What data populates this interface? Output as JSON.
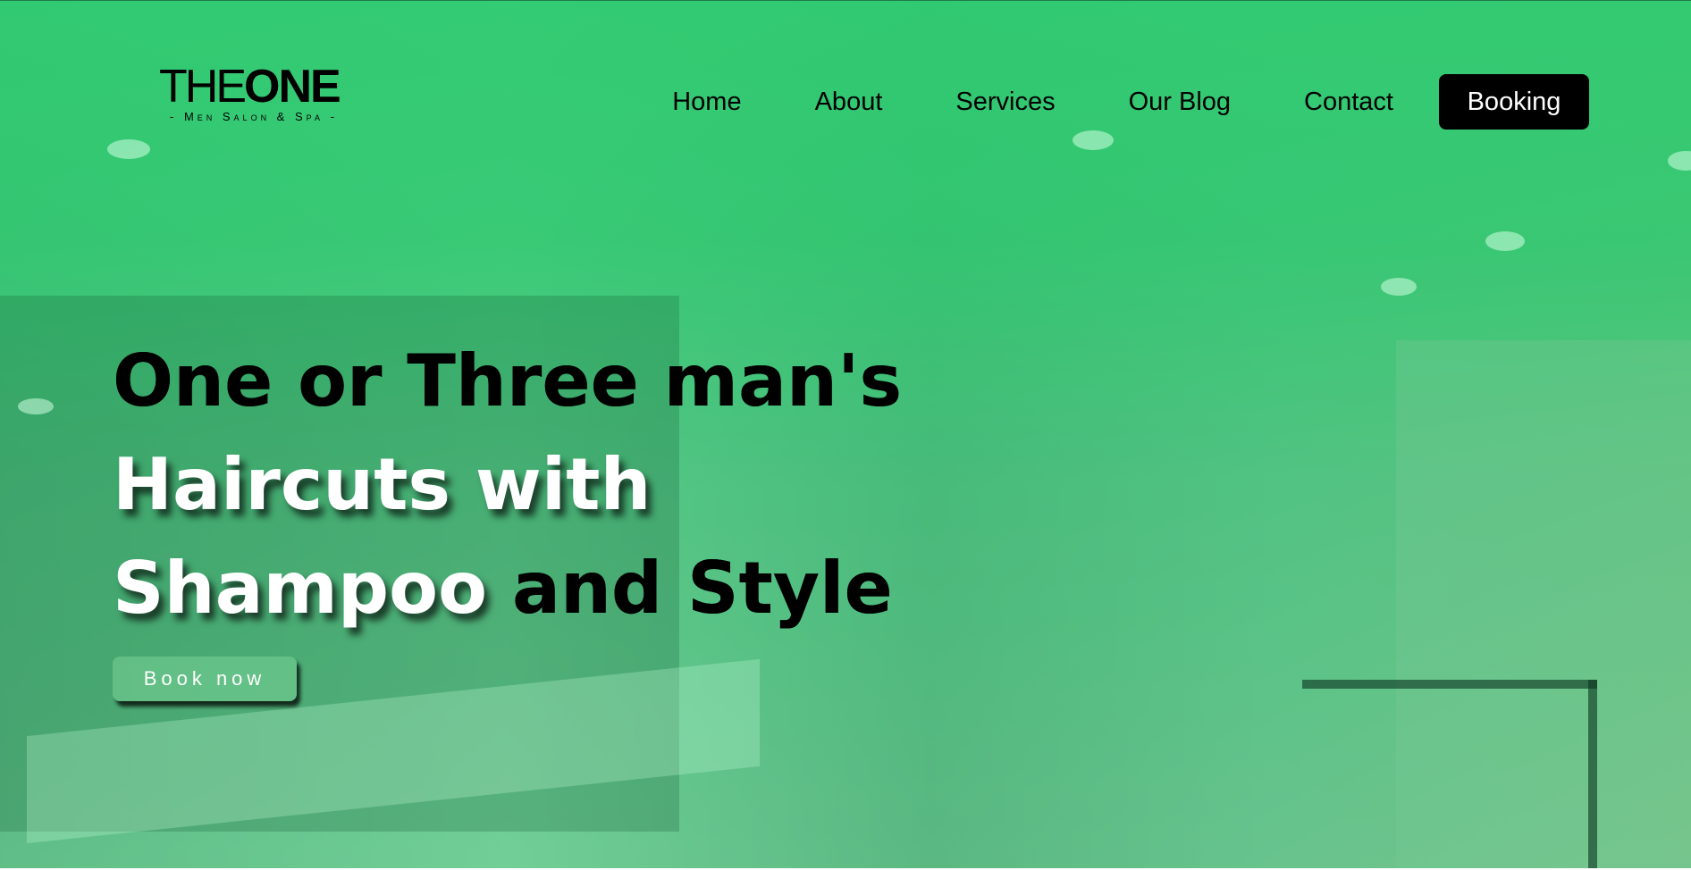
{
  "brand": {
    "logo_the": "THE",
    "logo_one": "ONE",
    "tagline": "- Men Salon & Spa -"
  },
  "nav": {
    "items": [
      {
        "label": "Home"
      },
      {
        "label": "About"
      },
      {
        "label": "Services"
      },
      {
        "label": "Our Blog"
      },
      {
        "label": "Contact"
      }
    ],
    "booking_label": "Booking"
  },
  "hero": {
    "line1": "One or Three man's",
    "line2": "Haircuts with",
    "line3_light": "Shampoo",
    "line3_dark": " and Style",
    "cta_label": "Book now",
    "background": "barbershop-photo",
    "overlay_color": "#2ecc71"
  }
}
